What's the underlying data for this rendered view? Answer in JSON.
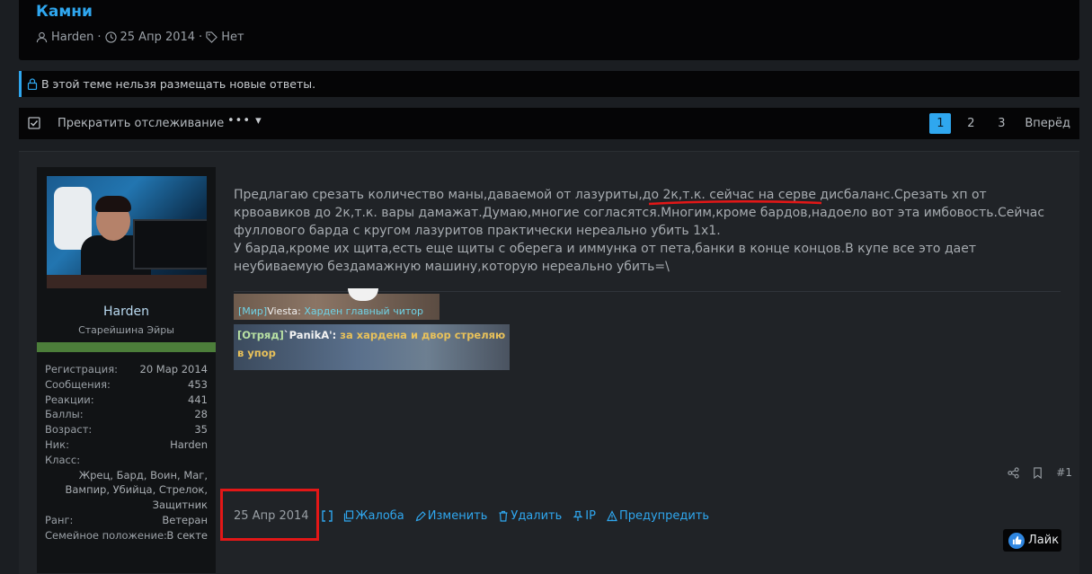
{
  "thread": {
    "title": "Камни",
    "author": "Harden",
    "date": "25 Апр 2014",
    "tags": "Нет"
  },
  "notice": "В этой теме нельзя размещать новые ответы.",
  "toolbar": {
    "unwatch": "Прекратить отслеживание",
    "more": "•••",
    "pages": [
      "1",
      "2",
      "3"
    ],
    "next": "Вперёд"
  },
  "user": {
    "name": "Harden",
    "title": "Старейшина Эйры",
    "stats": [
      {
        "k": "Регистрация:",
        "v": "20 Мар 2014"
      },
      {
        "k": "Сообщения:",
        "v": "453"
      },
      {
        "k": "Реакции:",
        "v": "441"
      },
      {
        "k": "Баллы:",
        "v": "28"
      },
      {
        "k": "Возраст:",
        "v": "35"
      },
      {
        "k": "Ник:",
        "v": "Harden"
      },
      {
        "k": "Класс:",
        "v": ""
      }
    ],
    "class_lines": [
      "Жрец, Бард, Воин, Маг,",
      "Вампир, Убийца, Стрелок,",
      "Защитник"
    ],
    "stats2": [
      {
        "k": "Ранг:",
        "v": "Ветеран"
      },
      {
        "k": "Семейное положение:",
        "v": "В секте"
      }
    ]
  },
  "message": {
    "p1_a": "Предлагаю срезать количество маны,даваемой от лазуриты,до 2к,т.к. ",
    "p1_u": "сейчас на серве дисбаланс.",
    "p1_b": "Срезать хп от крвоавиков до 2к,т.к. вары дамажат.Думаю,многие согласятся.Многим,кроме бардов,надоело вот эта имбовость.Сейчас фуллового барда с кругом лазуритов практически нереально убить 1х1.",
    "p2": "У барда,кроме их щита,есть еще щиты с оберега и иммунка от пета,банки в конце концов.В купе все это дает неубиваемую бездамажную машину,которую нереально убить=\\"
  },
  "img1": {
    "tag": "[Мир]",
    "name": "Viesta: ",
    "text": "Харден главный читор"
  },
  "img2": {
    "tag": "[Отряд]",
    "name": "`PanikA': ",
    "text": "за хардена и двор стреляю в упор"
  },
  "post": {
    "number": "#1",
    "date": "25 Апр 2014",
    "actions": [
      "Жалоба",
      "Изменить",
      "Удалить",
      "IP",
      "Предупредить"
    ],
    "like": "Лайк"
  }
}
